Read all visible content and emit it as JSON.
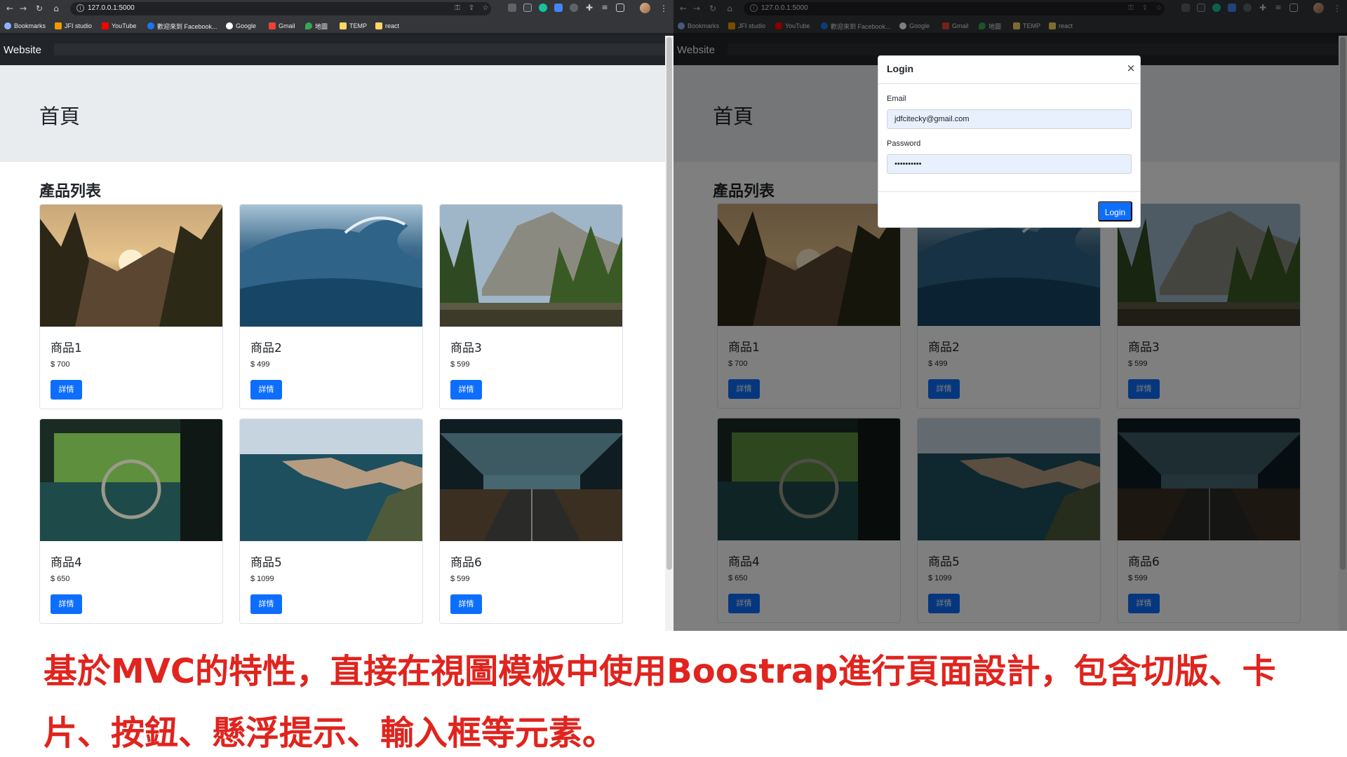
{
  "browser": {
    "url": "127.0.0.1:5000",
    "bookmarks": [
      {
        "label": "Bookmarks",
        "icon": "star-icon",
        "color": "#8ab4f8"
      },
      {
        "label": "JFI studio",
        "icon": "jfi-icon",
        "color": "#f29900"
      },
      {
        "label": "YouTube",
        "icon": "youtube-icon",
        "color": "#ff0000"
      },
      {
        "label": "歡迎來到 Facebook...",
        "icon": "facebook-icon",
        "color": "#1877f2"
      },
      {
        "label": "Google",
        "icon": "google-icon",
        "color": "#ffffff"
      },
      {
        "label": "Gmail",
        "icon": "gmail-icon",
        "color": "#ea4335"
      },
      {
        "label": "地圖",
        "icon": "maps-icon",
        "color": "#34a853"
      },
      {
        "label": "TEMP",
        "icon": "folder-icon",
        "color": "#fdd663"
      },
      {
        "label": "react",
        "icon": "folder-icon",
        "color": "#fdd663"
      }
    ]
  },
  "site": {
    "brand": "Website",
    "jumbotron_title": "首頁",
    "section_title": "產品列表",
    "detail_button_label": "詳情",
    "products": [
      {
        "name": "商品1",
        "price": "$ 700",
        "image": "mountain-sunset"
      },
      {
        "name": "商品2",
        "price": "$ 499",
        "image": "ocean-wave"
      },
      {
        "name": "商品3",
        "price": "$ 599",
        "image": "yosemite-valley"
      },
      {
        "name": "商品4",
        "price": "$ 650",
        "image": "car-interior"
      },
      {
        "name": "商品5",
        "price": "$ 1099",
        "image": "coastal-cliffs"
      },
      {
        "name": "商品6",
        "price": "$ 599",
        "image": "escalator-station"
      }
    ]
  },
  "modal": {
    "title": "Login",
    "close_symbol": "×",
    "email_label": "Email",
    "email_value": "jdfcitecky@gmail.com",
    "password_label": "Password",
    "password_value": "••••••••••",
    "login_button": "Login"
  },
  "caption": {
    "line1": "基於MVC的特性，直接在視圖模板中使用Boostrap進行頁面設計，包含切版、卡",
    "line2": "片、按鈕、懸浮提示、輸入框等元素。"
  },
  "colors": {
    "primary": "#0d6efd",
    "caption": "#e0241e",
    "navbar": "#212529",
    "jumbotron": "#e9ecef"
  }
}
